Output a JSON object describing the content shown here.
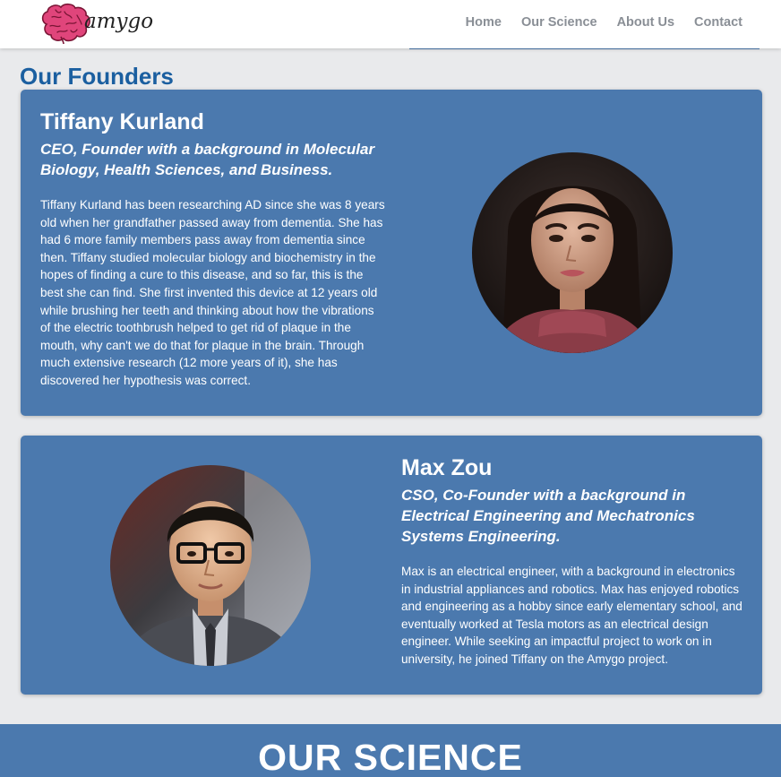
{
  "brand": {
    "name": "amygo",
    "logo_icon": "brain-icon"
  },
  "nav": {
    "items": [
      {
        "label": "Home"
      },
      {
        "label": "Our Science"
      },
      {
        "label": "About Us"
      },
      {
        "label": "Contact"
      }
    ]
  },
  "founders": {
    "title": "Our Founders",
    "people": [
      {
        "name": "Tiffany Kurland",
        "role": "CEO, Founder with a background in Molecular Biology, Health Sciences, and Business.",
        "bio": "Tiffany Kurland has been researching AD since she was 8 years old when her grandfather passed away from dementia. She has had 6 more family members pass away from dementia since then. Tiffany studied molecular biology and biochemistry in the hopes of finding a cure to this disease, and so far, this is the best she can find. She first invented this device at 12 years old while brushing her teeth and thinking about how the vibrations of the electric toothbrush helped to get rid of plaque in the mouth, why can't we do that for plaque in the brain. Through much extensive research (12 more years of it), she has discovered her hypothesis was correct."
      },
      {
        "name": "Max Zou",
        "role": "CSO, Co-Founder with a background in Electrical Engineering and Mechatronics Systems Engineering.",
        "bio": "Max is an electrical engineer, with a background in electronics in industrial appliances and robotics. Max has enjoyed robotics and engineering as a hobby since early elementary school, and eventually worked at Tesla motors as an electrical design engineer. While seeking an impactful project to work on in university, he joined Tiffany on the Amygo project."
      }
    ]
  },
  "next_section": {
    "title": "OUR SCIENCE"
  },
  "colors": {
    "accent": "#4b79ae",
    "heading": "#1b5fa0",
    "nav_text": "#8a8f96",
    "background": "#e9eaec",
    "logo_pink": "#e0457b"
  }
}
